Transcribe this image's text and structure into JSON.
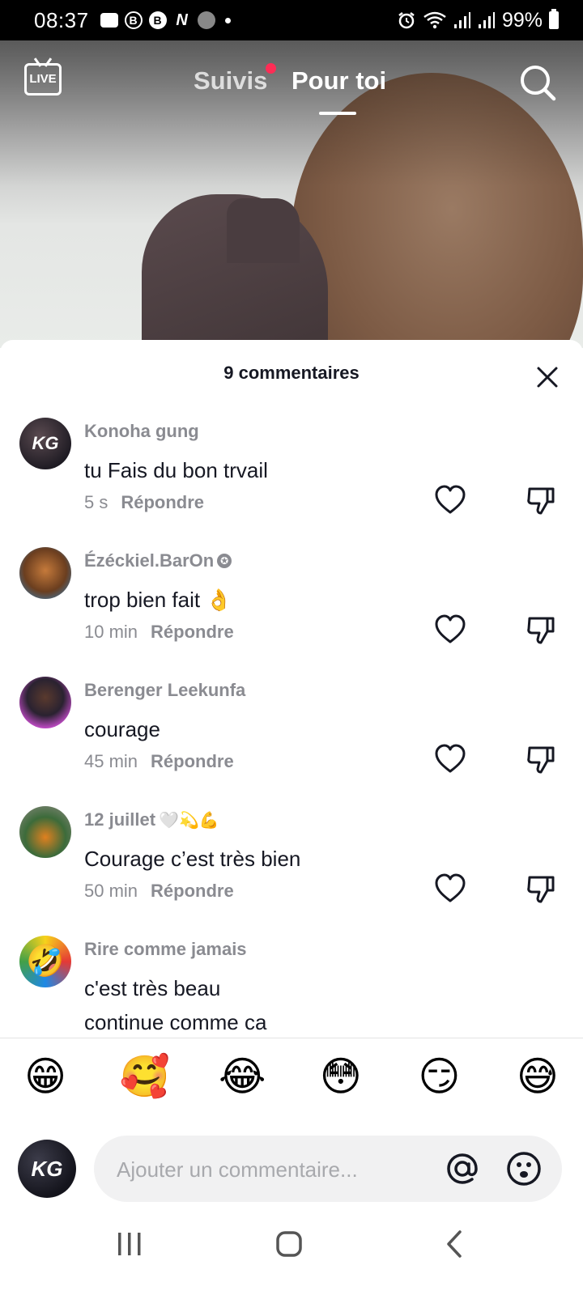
{
  "status_bar": {
    "time": "08:37",
    "battery": "99%",
    "notification_icons": [
      "message-icon",
      "b-circle-icon",
      "b-filled-icon",
      "n-app-icon",
      "reddit-icon"
    ],
    "system_icons": [
      "alarm-icon",
      "wifi-icon",
      "signal-icon",
      "signal-icon",
      "battery-icon"
    ]
  },
  "top_nav": {
    "live_label": "LIVE",
    "tabs": [
      {
        "label": "Suivis",
        "active": false,
        "has_dot": true
      },
      {
        "label": "Pour toi",
        "active": true
      }
    ]
  },
  "comments_panel": {
    "title": "9 commentaires",
    "reply_label": "Répondre",
    "comments": [
      {
        "user": "Konoha gung",
        "text": "tu Fais du bon trvail",
        "time": "5 s",
        "avatar_initials": "KG"
      },
      {
        "user": "Ézéckiel.BarOn",
        "verified_glyph": "✪",
        "text": "trop bien fait 👌",
        "time": "10 min"
      },
      {
        "user": "Berenger Leekunfa",
        "text": "courage",
        "time": "45 min"
      },
      {
        "user": "12 juillet",
        "user_emoji": "🤍💫💪",
        "text": "Courage c’est très bien",
        "time": "50 min"
      },
      {
        "user": "Rire comme jamais",
        "text_lines": [
          "c'est très beau",
          "continue comme ca"
        ]
      }
    ],
    "emoji_bar": [
      "😁",
      "🥰",
      "😂",
      "😳",
      "😏",
      "😅"
    ],
    "input": {
      "placeholder": "Ajouter un commentaire...",
      "value": "",
      "avatar_initials": "KG"
    }
  },
  "colors": {
    "accent_dot": "#fe2c55",
    "text_primary": "#161823",
    "text_secondary": "#8a8b91"
  }
}
